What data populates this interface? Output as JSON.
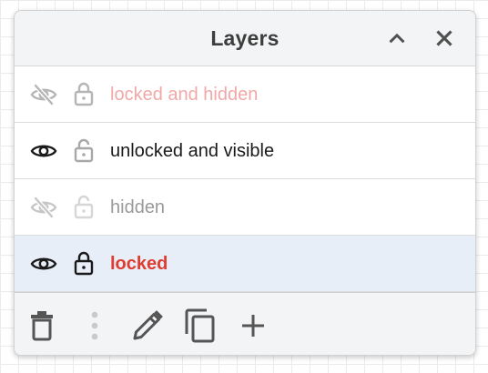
{
  "panel": {
    "title": "Layers",
    "collapse_icon": "chevron-up-icon",
    "close_icon": "close-icon"
  },
  "layers": [
    {
      "label": "locked and hidden",
      "visible": false,
      "locked": true,
      "selected": false,
      "label_color": "#f0a8a8",
      "icon_color": "#b5b5b5",
      "bold": false
    },
    {
      "label": "unlocked and visible",
      "visible": true,
      "locked": false,
      "selected": false,
      "label_color": "#1a1a1a",
      "eye_color": "#1a1a1a",
      "lock_color": "#a8a8a8",
      "bold": false
    },
    {
      "label": "hidden",
      "visible": false,
      "locked": false,
      "selected": false,
      "label_color": "#9a9a9a",
      "icon_color": "#cfcfcf",
      "bold": false
    },
    {
      "label": "locked",
      "visible": true,
      "locked": true,
      "selected": true,
      "label_color": "#e03b2f",
      "icon_color": "#1a1a1a",
      "bold": true
    }
  ],
  "toolbar": {
    "items": [
      "trash-icon",
      "more-vertical-icon",
      "pencil-icon",
      "duplicate-icon",
      "plus-icon"
    ]
  },
  "colors": {
    "panel_bg": "#f3f4f5",
    "selected_row_bg": "#e8eef7",
    "icon_dark": "#555555"
  }
}
